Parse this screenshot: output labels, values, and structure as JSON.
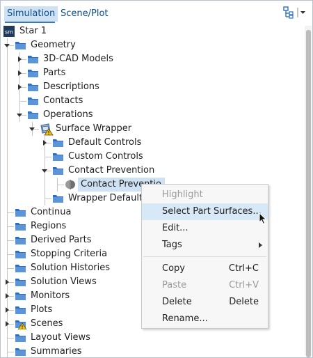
{
  "tabs": [
    {
      "label": "Simulation",
      "active": true
    },
    {
      "label": "Scene/Plot",
      "active": false
    }
  ],
  "toolbar": {
    "icons": [
      "tree-layout-icon",
      "dropdown-icon"
    ]
  },
  "tree": [
    {
      "label": "Star 1",
      "icon": "sim-icon",
      "level": 0,
      "expander": "none"
    },
    {
      "label": "Geometry",
      "icon": "folder-icon",
      "level": 0,
      "expander": "expanded"
    },
    {
      "label": "3D-CAD Models",
      "icon": "folder-icon",
      "level": 1,
      "expander": "collapsed"
    },
    {
      "label": "Parts",
      "icon": "folder-icon",
      "level": 1,
      "expander": "collapsed"
    },
    {
      "label": "Descriptions",
      "icon": "folder-icon",
      "level": 1,
      "expander": "collapsed"
    },
    {
      "label": "Contacts",
      "icon": "folder-icon",
      "level": 1,
      "expander": "none"
    },
    {
      "label": "Operations",
      "icon": "folder-icon",
      "level": 1,
      "expander": "expanded"
    },
    {
      "label": "Surface Wrapper",
      "icon": "surface-wrapper-warning-icon",
      "level": 2,
      "expander": "expanded"
    },
    {
      "label": "Default Controls",
      "icon": "folder-icon",
      "level": 3,
      "expander": "collapsed"
    },
    {
      "label": "Custom Controls",
      "icon": "folder-icon",
      "level": 3,
      "expander": "none"
    },
    {
      "label": "Contact Prevention",
      "icon": "folder-icon",
      "level": 3,
      "expander": "expanded"
    },
    {
      "label": "Contact Preventio",
      "icon": "contact-prevention-icon",
      "level": 4,
      "expander": "none",
      "selected": true
    },
    {
      "label": "Wrapper Defaults",
      "icon": "folder-icon",
      "level": 3,
      "expander": "none"
    },
    {
      "label": "Continua",
      "icon": "folder-icon",
      "level": 0,
      "expander": "none"
    },
    {
      "label": "Regions",
      "icon": "folder-icon",
      "level": 0,
      "expander": "none"
    },
    {
      "label": "Derived Parts",
      "icon": "folder-icon",
      "level": 0,
      "expander": "none"
    },
    {
      "label": "Stopping Criteria",
      "icon": "folder-icon",
      "level": 0,
      "expander": "none"
    },
    {
      "label": "Solution Histories",
      "icon": "folder-icon",
      "level": 0,
      "expander": "none"
    },
    {
      "label": "Solution Views",
      "icon": "folder-icon",
      "level": 0,
      "expander": "collapsed"
    },
    {
      "label": "Monitors",
      "icon": "folder-icon",
      "level": 0,
      "expander": "collapsed"
    },
    {
      "label": "Plots",
      "icon": "folder-icon",
      "level": 0,
      "expander": "collapsed"
    },
    {
      "label": "Scenes",
      "icon": "folder-warning-icon",
      "level": 0,
      "expander": "collapsed"
    },
    {
      "label": "Layout Views",
      "icon": "folder-icon",
      "level": 0,
      "expander": "none"
    },
    {
      "label": "Summaries",
      "icon": "folder-icon",
      "level": 0,
      "expander": "none"
    }
  ],
  "context_menu": {
    "items": [
      {
        "label": "Highlight",
        "shortcut": "",
        "disabled": true,
        "submenu": false
      },
      {
        "label": "Select Part Surfaces...",
        "shortcut": "",
        "disabled": false,
        "highlighted": true,
        "submenu": false
      },
      {
        "label": "Edit...",
        "shortcut": "",
        "disabled": false,
        "submenu": false
      },
      {
        "label": "Tags",
        "shortcut": "",
        "disabled": false,
        "submenu": true
      },
      {
        "separator": true
      },
      {
        "label": "Copy",
        "shortcut": "Ctrl+C",
        "disabled": false,
        "submenu": false
      },
      {
        "label": "Paste",
        "shortcut": "Ctrl+V",
        "disabled": true,
        "submenu": false
      },
      {
        "label": "Delete",
        "shortcut": "Delete",
        "disabled": false,
        "submenu": false
      },
      {
        "label": "Rename...",
        "shortcut": "",
        "disabled": false,
        "submenu": false
      }
    ]
  },
  "colors": {
    "accent": "#cfe2f4",
    "folder": "#2f6fc0",
    "tab_text": "#0b4e8b"
  }
}
